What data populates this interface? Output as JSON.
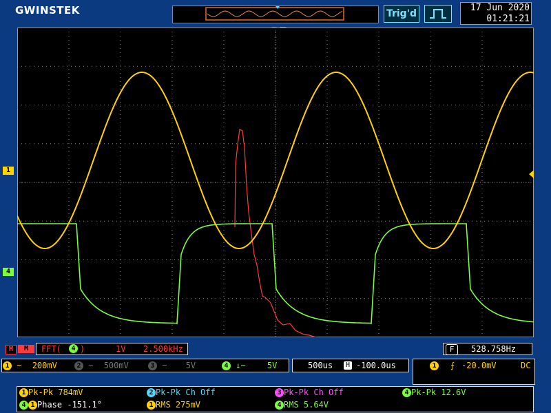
{
  "brand": {
    "logo": "GWINSTEK"
  },
  "header": {
    "trigger_status": "Trig'd",
    "trigger_mode_icon": "pulse-icon",
    "date": "17 Jun 2020",
    "time": "01:21:21"
  },
  "markers": {
    "ch1": "1",
    "ch4": "4",
    "math_fft": "M"
  },
  "fft_bar": {
    "label": "FFT(",
    "source": "4",
    "close": ")",
    "scale": "1V",
    "span": "2.500kHz",
    "cursor_badge": "F",
    "cursor_freq": "528.758Hz"
  },
  "channels": {
    "ch1": {
      "num": "1",
      "coupling": "~",
      "scale": "200mV"
    },
    "ch2": {
      "num": "2",
      "coupling": "~",
      "scale": "500mV"
    },
    "ch3": {
      "num": "3",
      "coupling": "~",
      "scale": "5V"
    },
    "ch4": {
      "num": "4",
      "coupling": "↓~",
      "scale": "5V"
    }
  },
  "timebase": {
    "scale": "500us",
    "pos_badge": "H",
    "position": "-100.0us"
  },
  "trigger": {
    "source": "1",
    "slope": "⨍",
    "level": "-20.0mV",
    "coupling": "DC"
  },
  "measurements": [
    {
      "ch": "1",
      "text": "Pk-Pk 784mV"
    },
    {
      "ch": "2",
      "text": "Pk-Pk Ch Off"
    },
    {
      "ch": "3",
      "text": "Pk-Pk Ch Off"
    },
    {
      "ch": "4",
      "text": "Pk-Pk 12.6V"
    },
    {
      "ch": "4",
      "ch2": "1",
      "text": "Phase -151.1°"
    },
    {
      "ch": "1",
      "text": "RMS 275mV"
    },
    {
      "ch": "4",
      "text": "RMS 5.64V"
    }
  ],
  "colors": {
    "ch1": "#ffd200",
    "ch2": "#4ed8ff",
    "ch3": "#ff4dff",
    "ch4": "#7cfc3c",
    "math": "#ff3a3a"
  }
}
